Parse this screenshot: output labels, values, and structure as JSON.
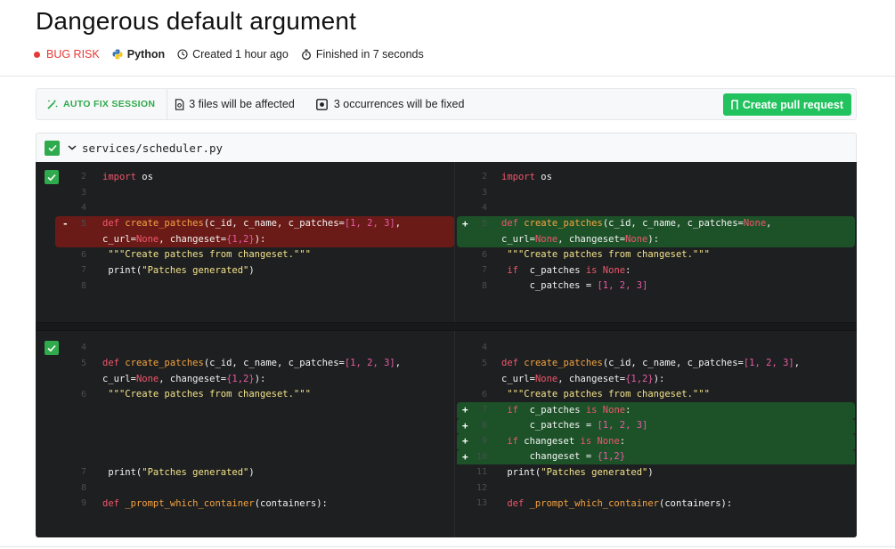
{
  "header": {
    "title": "Dangerous default argument",
    "category": "BUG RISK",
    "language": "Python",
    "created": "Created 1 hour ago",
    "finished": "Finished in 7 seconds",
    "colors": {
      "bug_risk": "#e53935",
      "accent_green": "#22c35e"
    }
  },
  "toolbar": {
    "autofix_label": "AUTO FIX SESSION",
    "files_affected": "3 files will be affected",
    "occurrences": "3 occurrences will be fixed",
    "pull_request_label": "Create pull request"
  },
  "file": {
    "name": "services/scheduler.py"
  },
  "hunks": [
    {
      "left": [
        {
          "num": "2",
          "marker": "",
          "code": [
            [
              "k",
              "import "
            ],
            [
              "w",
              "os"
            ]
          ]
        },
        {
          "num": "3",
          "marker": "",
          "code": []
        },
        {
          "num": "4",
          "marker": "",
          "code": []
        },
        {
          "num": "5",
          "marker": "-",
          "code": [
            [
              "k",
              "def "
            ],
            [
              "f",
              "create_patches"
            ],
            [
              "w",
              "(c_id, c_name, c_patches="
            ],
            [
              "n",
              "[1, 2, 3]"
            ],
            [
              "w",
              ","
            ]
          ]
        },
        {
          "num": "",
          "marker": "",
          "cont": "del",
          "code": [
            [
              "w",
              "c_url="
            ],
            [
              "k",
              "None"
            ],
            [
              "w",
              ", changeset="
            ],
            [
              "n",
              "{1,2}"
            ],
            [
              "w",
              "):"
            ]
          ]
        },
        {
          "num": "6",
          "marker": "",
          "code": [
            [
              "s",
              " \"\"\"Create patches from changeset.\"\"\""
            ]
          ]
        },
        {
          "num": "7",
          "marker": "",
          "code": [
            [
              "w",
              " print("
            ],
            [
              "s",
              "\"Patches generated\""
            ],
            [
              "w",
              ")"
            ]
          ]
        },
        {
          "num": "8",
          "marker": "",
          "code": []
        }
      ],
      "right": [
        {
          "num": "2",
          "marker": "",
          "code": [
            [
              "k",
              "import "
            ],
            [
              "w",
              "os"
            ]
          ]
        },
        {
          "num": "3",
          "marker": "",
          "code": []
        },
        {
          "num": "4",
          "marker": "",
          "code": []
        },
        {
          "num": "5",
          "marker": "+",
          "code": [
            [
              "k",
              "def "
            ],
            [
              "f",
              "create_patches"
            ],
            [
              "w",
              "(c_id, c_name, c_patches="
            ],
            [
              "k",
              "None"
            ],
            [
              "w",
              ","
            ]
          ]
        },
        {
          "num": "",
          "marker": "",
          "cont": "add",
          "code": [
            [
              "w",
              "c_url="
            ],
            [
              "k",
              "None"
            ],
            [
              "w",
              ", changeset="
            ],
            [
              "k",
              "None"
            ],
            [
              "w",
              "):"
            ]
          ]
        },
        {
          "num": "6",
          "marker": "",
          "code": [
            [
              "s",
              " \"\"\"Create patches from changeset.\"\"\""
            ]
          ]
        },
        {
          "num": "7",
          "marker": "",
          "code": [
            [
              "k",
              " if "
            ],
            [
              "w",
              " c_patches "
            ],
            [
              "k",
              "is None"
            ],
            [
              "w",
              ":"
            ]
          ]
        },
        {
          "num": "8",
          "marker": "",
          "code": [
            [
              "w",
              "     c_patches = "
            ],
            [
              "n",
              "[1, 2, 3]"
            ]
          ]
        }
      ]
    },
    {
      "left": [
        {
          "num": "4",
          "marker": "",
          "code": []
        },
        {
          "num": "5",
          "marker": "",
          "code": [
            [
              "k",
              "def "
            ],
            [
              "f",
              "create_patches"
            ],
            [
              "w",
              "(c_id, c_name, c_patches="
            ],
            [
              "n",
              "[1, 2, 3]"
            ],
            [
              "w",
              ","
            ]
          ]
        },
        {
          "num": "",
          "marker": "",
          "cont": "plain",
          "code": [
            [
              "w",
              "c_url="
            ],
            [
              "k",
              "None"
            ],
            [
              "w",
              ", changeset="
            ],
            [
              "n",
              "{1,2}"
            ],
            [
              "w",
              "):"
            ]
          ]
        },
        {
          "num": "6",
          "marker": "",
          "code": [
            [
              "s",
              " \"\"\"Create patches from changeset.\"\"\""
            ]
          ]
        },
        {
          "num": "",
          "marker": "",
          "code": []
        },
        {
          "num": "",
          "marker": "",
          "code": []
        },
        {
          "num": "",
          "marker": "",
          "code": []
        },
        {
          "num": "",
          "marker": "",
          "code": []
        },
        {
          "num": "7",
          "marker": "",
          "code": [
            [
              "w",
              " print("
            ],
            [
              "s",
              "\"Patches generated\""
            ],
            [
              "w",
              ")"
            ]
          ]
        },
        {
          "num": "8",
          "marker": "",
          "code": []
        },
        {
          "num": "9",
          "marker": "",
          "code": [
            [
              "k",
              "def "
            ],
            [
              "f",
              "_prompt_which_container"
            ],
            [
              "w",
              "(containers):"
            ]
          ]
        }
      ],
      "right": [
        {
          "num": "4",
          "marker": "",
          "code": []
        },
        {
          "num": "5",
          "marker": "",
          "code": [
            [
              "k",
              "def "
            ],
            [
              "f",
              "create_patches"
            ],
            [
              "w",
              "(c_id, c_name, c_patches="
            ],
            [
              "n",
              "[1, 2, 3]"
            ],
            [
              "w",
              ","
            ]
          ]
        },
        {
          "num": "",
          "marker": "",
          "cont": "plain",
          "code": [
            [
              "w",
              "c_url="
            ],
            [
              "k",
              "None"
            ],
            [
              "w",
              ", changeset="
            ],
            [
              "n",
              "{1,2}"
            ],
            [
              "w",
              "):"
            ]
          ]
        },
        {
          "num": "6",
          "marker": "",
          "code": [
            [
              "s",
              " \"\"\"Create patches from changeset.\"\"\""
            ]
          ]
        },
        {
          "num": "7",
          "marker": "+",
          "code": [
            [
              "k",
              " if "
            ],
            [
              "w",
              " c_patches "
            ],
            [
              "k",
              "is None"
            ],
            [
              "w",
              ":"
            ]
          ]
        },
        {
          "num": "8",
          "marker": "+",
          "code": [
            [
              "w",
              "     c_patches = "
            ],
            [
              "n",
              "[1, 2, 3]"
            ]
          ]
        },
        {
          "num": "9",
          "marker": "+",
          "code": [
            [
              "k",
              " if "
            ],
            [
              "w",
              "changeset "
            ],
            [
              "k",
              "is None"
            ],
            [
              "w",
              ":"
            ]
          ]
        },
        {
          "num": "10",
          "marker": "+",
          "code": [
            [
              "w",
              "     changeset = "
            ],
            [
              "n",
              "{1,2}"
            ]
          ]
        },
        {
          "num": "11",
          "marker": "",
          "code": [
            [
              "w",
              " print("
            ],
            [
              "s",
              "\"Patches generated\""
            ],
            [
              "w",
              ")"
            ]
          ]
        },
        {
          "num": "12",
          "marker": "",
          "code": []
        },
        {
          "num": "13",
          "marker": "",
          "code": [
            [
              "k",
              " def "
            ],
            [
              "f",
              "_prompt_which_container"
            ],
            [
              "w",
              "(containers):"
            ]
          ]
        }
      ]
    }
  ]
}
